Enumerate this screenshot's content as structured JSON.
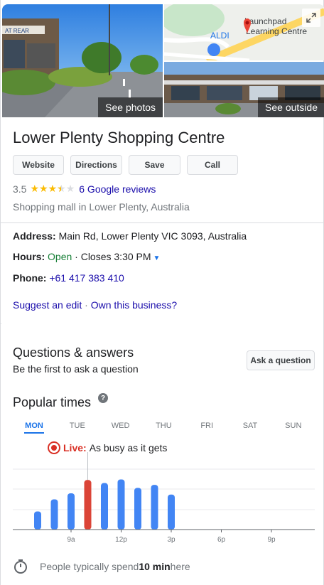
{
  "photos": {
    "main_label": "See photos",
    "outside_label": "See outside",
    "map_labels": {
      "aldi": "ALDI",
      "launchpad": "Launchpad",
      "learning": "Learning Centre",
      "shop_sign": "AT REAR"
    }
  },
  "place": {
    "name": "Lower Plenty Shopping Centre",
    "rating": "3.5",
    "reviews_link": "6 Google reviews",
    "category": "Shopping mall in Lower Plenty, Australia"
  },
  "actions": {
    "website": "Website",
    "directions": "Directions",
    "save": "Save",
    "call": "Call"
  },
  "details": {
    "address_label": "Address:",
    "address_value": "Main Rd, Lower Plenty VIC 3093, Australia",
    "hours_label": "Hours:",
    "hours_status": "Open",
    "hours_detail": " · Closes 3:30 PM",
    "phone_label": "Phone:",
    "phone_value": "+61 417 383 410",
    "suggest_edit": "Suggest an edit",
    "separator": " · ",
    "own_business": "Own this business?"
  },
  "qa": {
    "heading": "Questions & answers",
    "first_link": "Be the first to ask a question",
    "ask_button": "Ask a question"
  },
  "popular_times": {
    "heading": "Popular times",
    "help_icon": "?",
    "days": [
      "MON",
      "TUE",
      "WED",
      "THU",
      "FRI",
      "SAT",
      "SUN"
    ],
    "active_day": "MON",
    "live_label": "Live:",
    "live_text": "As busy as it gets",
    "spend_prefix": "People typically spend ",
    "spend_value": "10 min",
    "spend_suffix": " here"
  },
  "colors": {
    "bar": "#4285f4",
    "live_bar": "#db4437",
    "accent": "#1a73e8",
    "link": "#1a0dab",
    "open": "#188038"
  },
  "chart_data": {
    "type": "bar",
    "day": "MON",
    "x_ticks": [
      "9a",
      "12p",
      "3p",
      "6p",
      "9p"
    ],
    "hours": [
      "7a",
      "8a",
      "9a",
      "10a",
      "11a",
      "12p",
      "1p",
      "2p",
      "3p",
      "4p",
      "5p",
      "6p",
      "7p",
      "8p",
      "9p",
      "10p",
      "11p"
    ],
    "values": [
      30,
      50,
      60,
      82,
      77,
      83,
      69,
      74,
      58,
      0,
      0,
      0,
      0,
      0,
      0,
      0,
      0
    ],
    "live_hour": "10a",
    "ylim": [
      0,
      100
    ]
  }
}
